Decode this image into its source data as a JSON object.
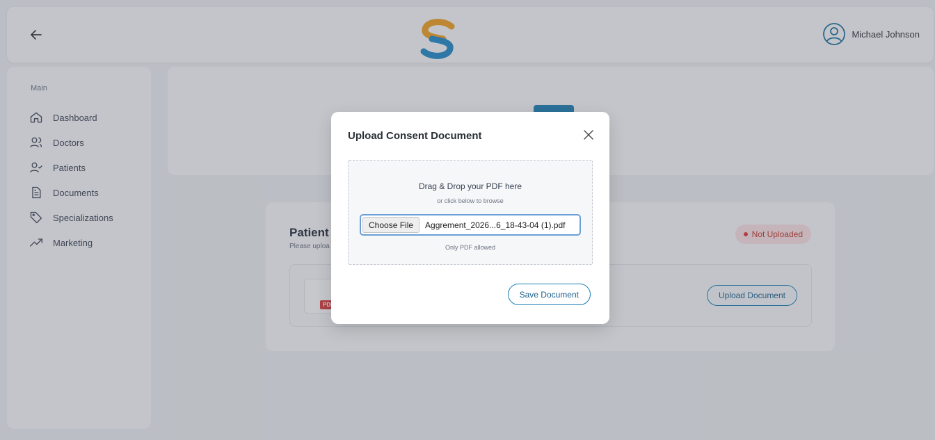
{
  "header": {
    "user_name": "Michael Johnson"
  },
  "sidebar": {
    "section_label": "Main",
    "items": [
      {
        "label": "Dashboard",
        "icon": "home-icon"
      },
      {
        "label": "Doctors",
        "icon": "users-icon"
      },
      {
        "label": "Patients",
        "icon": "user-check-icon"
      },
      {
        "label": "Documents",
        "icon": "document-icon"
      },
      {
        "label": "Specializations",
        "icon": "tag-icon"
      },
      {
        "label": "Marketing",
        "icon": "trending-up-icon"
      }
    ]
  },
  "consent_card": {
    "title": "Patient",
    "subtitle": "Please uploa",
    "status": "Not Uploaded",
    "pdf_chip": "PDF",
    "upload_button": "Upload Document"
  },
  "modal": {
    "title": "Upload Consent Document",
    "drop_title": "Drag & Drop your PDF here",
    "drop_subtitle": "or click below to browse",
    "choose_file_label": "Choose File",
    "file_name": "Aggrement_2026...6_18-43-04 (1).pdf",
    "note": "Only PDF allowed",
    "save_button": "Save Document"
  },
  "colors": {
    "accent": "#1a7fb4",
    "status_red": "#d93a3a"
  }
}
